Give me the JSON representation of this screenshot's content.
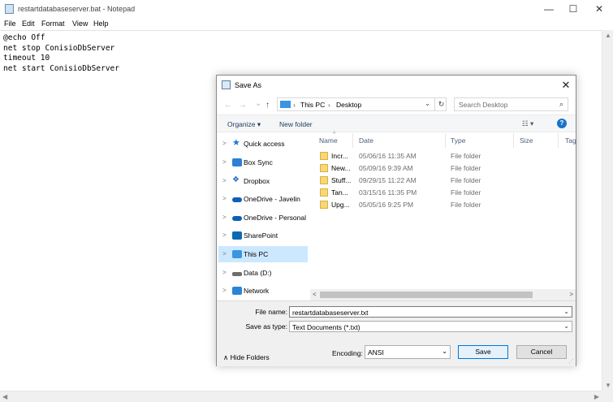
{
  "notepad": {
    "title": "restartdatabaseserver.bat - Notepad",
    "minimize": "—",
    "maximize": "☐",
    "close": "✕",
    "menu": [
      "File",
      "Edit",
      "Format",
      "View",
      "Help"
    ],
    "content_lines": [
      "@echo Off",
      "net stop ConisioDbServer",
      "timeout 10",
      "net start ConisioDbServer"
    ]
  },
  "dialog": {
    "title": "Save As",
    "close": "✕",
    "nav": {
      "back": "←",
      "forward": "→",
      "recent": "⌄",
      "up": "↑"
    },
    "address": {
      "crumbs": [
        "This PC",
        "Desktop"
      ],
      "separator": "›",
      "dropdown": "⌄",
      "refresh": "↻"
    },
    "search": {
      "placeholder": "Search Desktop",
      "icon": "⌕"
    },
    "toolbar": {
      "organize": "Organize ▾",
      "new_folder": "New folder",
      "view": "☷ ▾",
      "help": "?"
    },
    "nav_pane": [
      {
        "label": "Quick access",
        "icon": "star-icon",
        "color": "#1e76d0"
      },
      {
        "label": "Box Sync",
        "icon": "box-icon",
        "color": "#2d7fd3"
      },
      {
        "label": "Dropbox",
        "icon": "dropbox-icon",
        "color": "#1b68c7"
      },
      {
        "label": "OneDrive - Javelin",
        "icon": "cloud-icon",
        "color": "#0e5fb5"
      },
      {
        "label": "OneDrive - Personal",
        "icon": "cloud-icon",
        "color": "#0e5fb5"
      },
      {
        "label": "SharePoint",
        "icon": "sharepoint-icon",
        "color": "#0b6ab3"
      },
      {
        "label": "This PC",
        "icon": "monitor-icon",
        "color": "#3a95e3"
      },
      {
        "label": "Data (D:)",
        "icon": "drive-icon",
        "color": "#6d6d6d"
      },
      {
        "label": "Network",
        "icon": "network-icon",
        "color": "#2a85d6"
      }
    ],
    "columns": [
      "Name",
      "Date",
      "Type",
      "Size",
      "Tag"
    ],
    "files": [
      {
        "name": "Incr...",
        "date": "05/06/16 11:35 AM",
        "type": "File folder"
      },
      {
        "name": "New...",
        "date": "05/09/16 9:39 AM",
        "type": "File folder"
      },
      {
        "name": "Stuff...",
        "date": "09/29/15 11:22 AM",
        "type": "File folder"
      },
      {
        "name": "Tan...",
        "date": "03/15/16 11:35 PM",
        "type": "File folder"
      },
      {
        "name": "Upg...",
        "date": "05/05/16 9:25 PM",
        "type": "File folder"
      }
    ],
    "file_name_label": "File name:",
    "file_name_value": "restartdatabaseserver.txt",
    "save_type_label": "Save as type:",
    "save_type_value": "Text Documents (*.txt)",
    "hide_folders": "∧  Hide Folders",
    "encoding_label": "Encoding:",
    "encoding_value": "ANSI",
    "save_button": "Save",
    "cancel_button": "Cancel"
  }
}
